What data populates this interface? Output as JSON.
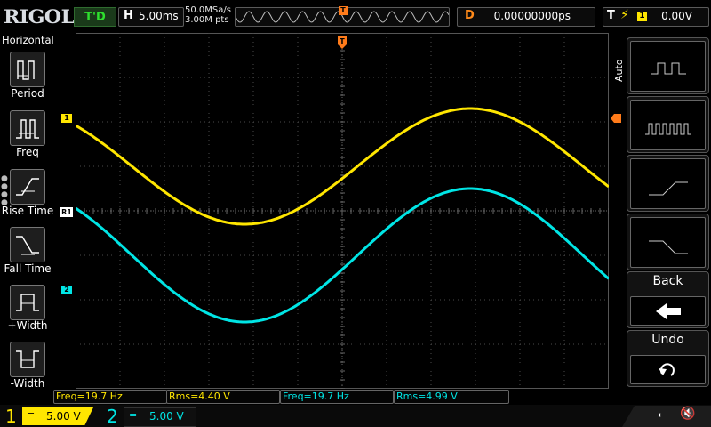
{
  "brand": "RIGOL",
  "top": {
    "run_status": "T'D",
    "horizontal": {
      "tag": "H",
      "value": "5.00ms"
    },
    "sample_rate": "50.0MSa/s",
    "memory_depth": "3.00M pts",
    "trig_pos_marker": "T",
    "delay": {
      "tag": "D",
      "value": "0.00000000ps"
    },
    "trigger": {
      "tag": "T",
      "source": "1",
      "level": "0.00V"
    }
  },
  "left_panel": {
    "title": "Horizontal",
    "buttons": [
      {
        "label": "Period"
      },
      {
        "label": "Freq"
      },
      {
        "label": "Rise Time"
      },
      {
        "label": "Fall Time"
      },
      {
        "label": "+Width"
      },
      {
        "label": "-Width"
      }
    ]
  },
  "markers": {
    "ch1": "1",
    "ch2": "2",
    "ref": "R1"
  },
  "right_panel": {
    "auto_label": "Auto",
    "back_label": "Back",
    "undo_label": "Undo"
  },
  "measurements": [
    {
      "text": "Freq=19.7 Hz"
    },
    {
      "text": "Rms=4.40 V"
    },
    {
      "text": "Freq=19.7 Hz"
    },
    {
      "text": "Rms=4.99 V"
    }
  ],
  "bottom": {
    "ch1": {
      "num": "1",
      "coupling": "=",
      "scale": "5.00 V"
    },
    "ch2": {
      "num": "2",
      "coupling": "=",
      "scale": "5.00 V"
    }
  },
  "colors": {
    "ch1": "#ffe600",
    "ch2": "#00e5e5",
    "trigger": "#ff7b1a",
    "run_status": "#2ee02e"
  },
  "waveforms": {
    "ch1": {
      "offset_div": 1.0,
      "peak_div": 1.3
    },
    "ch2": {
      "offset_div": -1.0,
      "peak_div": 1.5
    },
    "period_div": 10.15,
    "start_phase_deg": 135
  }
}
